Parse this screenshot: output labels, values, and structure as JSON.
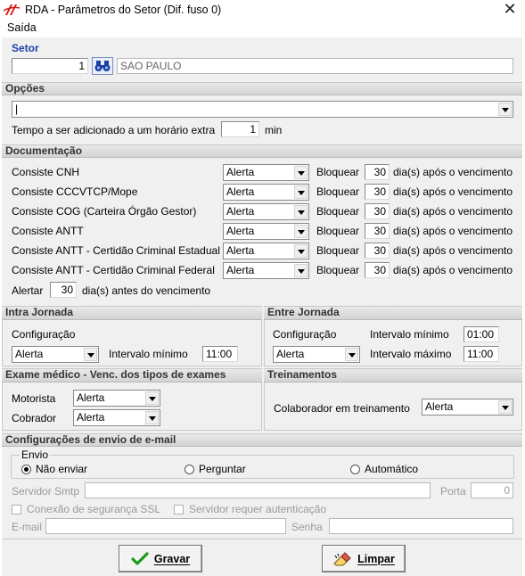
{
  "window": {
    "title": "RDA - Parâmetros do Setor (Dif. fuso 0)"
  },
  "menu": {
    "item": "Saída"
  },
  "setor": {
    "header": "Setor",
    "code": "1",
    "name": "SAO PAULO"
  },
  "opcoes": {
    "header": "Opções",
    "combo_value": "|",
    "extra_label": "Tempo a ser adicionado a um horário extra",
    "extra_value": "1",
    "extra_unit": "min"
  },
  "documentacao": {
    "header": "Documentação",
    "bloquear_label": "Bloquear",
    "dias_label": "dia(s) após o vencimento",
    "rows": [
      {
        "label": "Consiste CNH",
        "mode": "Alerta",
        "days": "30"
      },
      {
        "label": "Consiste CCCVTCP/Mope",
        "mode": "Alerta",
        "days": "30"
      },
      {
        "label": "Consiste COG (Carteira Órgão Gestor)",
        "mode": "Alerta",
        "days": "30"
      },
      {
        "label": "Consiste ANTT",
        "mode": "Alerta",
        "days": "30"
      },
      {
        "label": "Consiste ANTT - Certidão Criminal Estadual",
        "mode": "Alerta",
        "days": "30"
      },
      {
        "label": "Consiste ANTT - Certidão Criminal Federal",
        "mode": "Alerta",
        "days": "30"
      }
    ],
    "alertar_label": "Alertar",
    "alertar_value": "30",
    "alertar_suffix": "dia(s) antes do vencimento"
  },
  "intra": {
    "header": "Intra Jornada",
    "config_label": "Configuração",
    "config_value": "Alerta",
    "intervalo_label": "Intervalo mínimo",
    "intervalo_value": "11:00"
  },
  "entre": {
    "header": "Entre Jornada",
    "config_label": "Configuração",
    "config_value": "Alerta",
    "min_label": "Intervalo mínimo",
    "min_value": "01:00",
    "max_label": "Intervalo máximo",
    "max_value": "11:00"
  },
  "exame": {
    "header": "Exame médico - Venc. dos tipos de exames",
    "motorista_label": "Motorista",
    "motorista_value": "Alerta",
    "cobrador_label": "Cobrador",
    "cobrador_value": "Alerta"
  },
  "treinamentos": {
    "header": "Treinamentos",
    "label": "Colaborador em treinamento",
    "value": "Alerta"
  },
  "email": {
    "header": "Configurações de envio de e-mail",
    "envio_legend": "Envio",
    "opt_nao": "Não enviar",
    "opt_perguntar": "Perguntar",
    "opt_auto": "Automático",
    "selected": "Não enviar",
    "smtp_label": "Servidor Smtp",
    "porta_label": "Porta",
    "porta_value": "0",
    "ssl_label": "Conexão de segurança SSL",
    "auth_label": "Servidor requer autenticação",
    "email_label": "E-mail",
    "senha_label": "Senha"
  },
  "buttons": {
    "gravar": "Gravar",
    "limpar": "Limpar"
  },
  "colors": {
    "header_blue": "#1b3fa6",
    "panel_bg": "#f0f0f0",
    "gravar_check": "#1a9c1a"
  },
  "icons": [
    "app-logo-icon",
    "close-icon",
    "binoculars-icon",
    "checkmark-icon",
    "eraser-icon"
  ]
}
